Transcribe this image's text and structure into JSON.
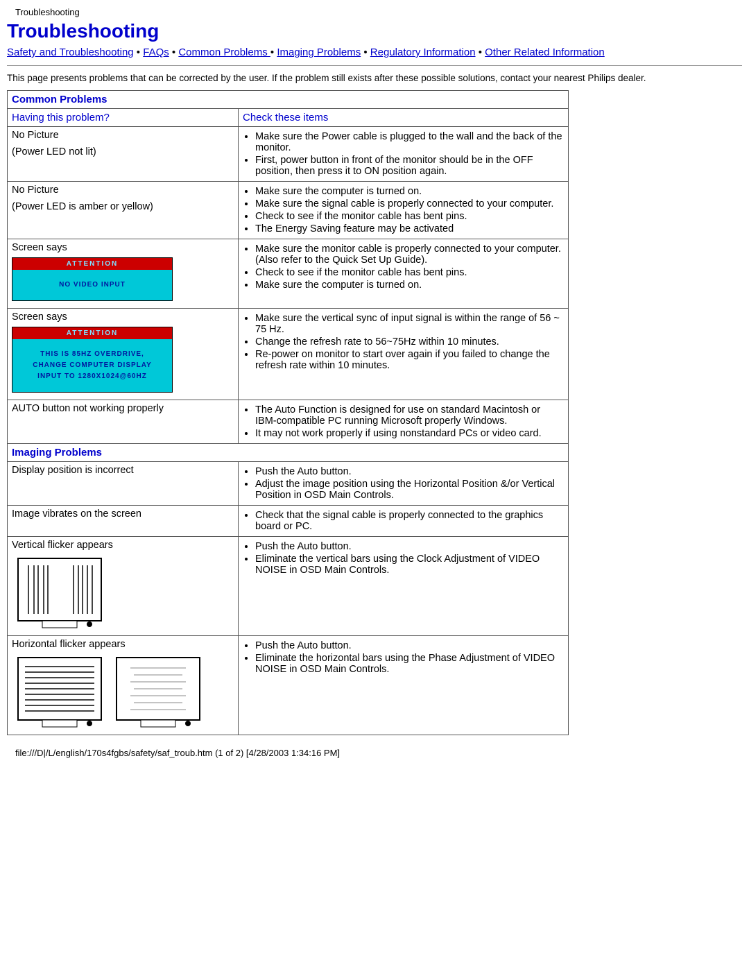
{
  "crumb": "Troubleshooting",
  "title": "Troubleshooting",
  "nav": {
    "safety": "Safety and Troubleshooting",
    "faqs": "FAQs",
    "common": "Common Problems ",
    "imaging": "Imaging Problems",
    "reg": "Regulatory Information",
    "other": "Other Related Information"
  },
  "intro": "This page presents problems that can be corrected by the user. If the problem still exists after these possible solutions, contact your nearest Philips dealer.",
  "sections": {
    "common": "Common Problems",
    "imaging": "Imaging Problems"
  },
  "subhead": {
    "having": "Having this problem?",
    "check": "Check these items"
  },
  "rows": {
    "r1": {
      "label1": "No Picture",
      "label2": "(Power LED not lit)",
      "items": [
        "Make sure the Power cable is plugged to the wall and the back of the monitor.",
        "First, power button in front of the monitor should be in the OFF position, then press it to ON position again."
      ]
    },
    "r2": {
      "label1": "No Picture",
      "label2": "(Power LED is amber or yellow)",
      "items": [
        "Make sure the computer is turned on.",
        "Make sure the signal cable is properly connected to your computer.",
        "Check to see if the monitor cable has bent pins.",
        "The Energy Saving feature may be activated"
      ]
    },
    "r3": {
      "label1": "Screen says",
      "alert": {
        "head": "ATTENTION",
        "body": [
          "NO VIDEO INPUT"
        ]
      },
      "items": [
        "Make sure the monitor cable is properly connected to your computer. (Also refer to the Quick Set Up Guide).",
        "Check to see if the monitor cable has bent pins.",
        "Make sure the computer is turned on."
      ]
    },
    "r4": {
      "label1": "Screen says",
      "alert": {
        "head": "ATTENTION",
        "body": [
          "THIS IS 85HZ OVERDRIVE,",
          "CHANGE COMPUTER DISPLAY",
          "INPUT TO 1280X1024@60HZ"
        ]
      },
      "items": [
        "Make sure the vertical sync of input signal is within the range of 56 ~ 75 Hz.",
        "Change the refresh rate to 56~75Hz within 10 minutes.",
        "Re-power on monitor to start over again if you failed to change the refresh rate within 10 minutes."
      ]
    },
    "r5": {
      "label1": "AUTO button not working properly",
      "items": [
        "The Auto Function is designed for use on standard Macintosh or IBM-compatible PC running Microsoft properly Windows.",
        "It may not work properly if using nonstandard PCs or video card."
      ]
    },
    "r6": {
      "label1": "Display position is incorrect",
      "items": [
        "Push the Auto button.",
        "Adjust the image position using the Horizontal Position &/or Vertical Position in OSD Main Controls."
      ]
    },
    "r7": {
      "label1": "Image vibrates on the screen",
      "items": [
        "Check that the signal cable is properly connected to the graphics board or PC."
      ]
    },
    "r8": {
      "label1": "Vertical flicker appears",
      "items": [
        "Push the Auto button.",
        "Eliminate the vertical bars using the Clock Adjustment of VIDEO NOISE in OSD Main Controls."
      ]
    },
    "r9": {
      "label1": "Horizontal flicker appears",
      "items": [
        "Push the Auto button.",
        "Eliminate the horizontal bars using the Phase Adjustment of VIDEO NOISE in OSD Main Controls."
      ]
    }
  },
  "footer": "file:///D|/L/english/170s4fgbs/safety/saf_troub.htm (1 of 2) [4/28/2003 1:34:16 PM]"
}
